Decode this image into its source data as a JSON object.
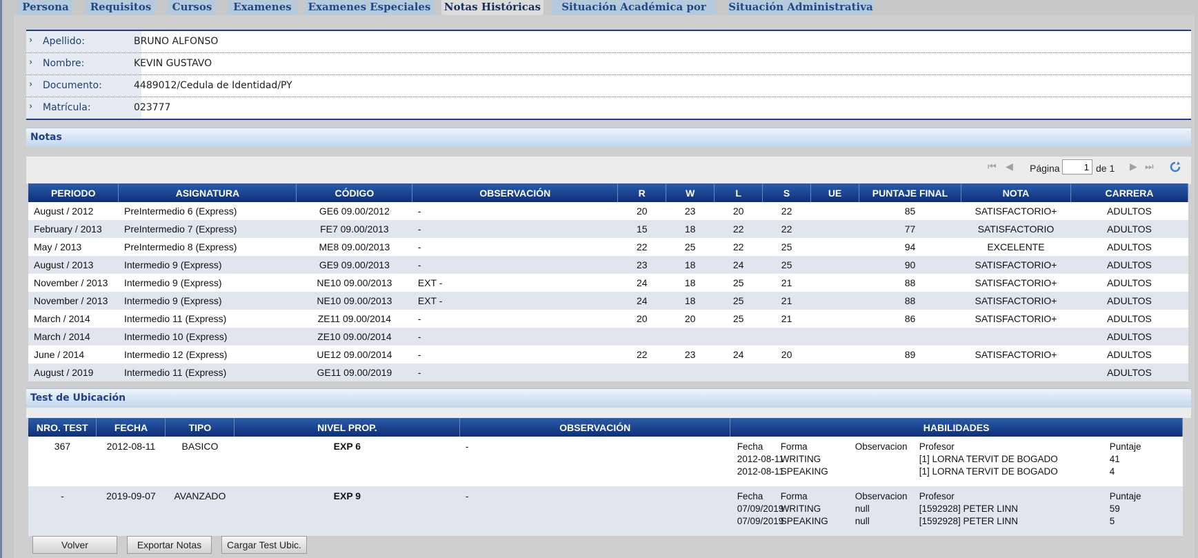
{
  "tabs": [
    {
      "label": "Persona"
    },
    {
      "label": "Requisitos"
    },
    {
      "label": "Cursos"
    },
    {
      "label": "Examenes"
    },
    {
      "label": "Examenes Especiales"
    },
    {
      "label": "Notas Históricas"
    },
    {
      "label": "Situación Académica por Año"
    },
    {
      "label": "Situación Administrativa"
    }
  ],
  "info": {
    "apellido_label": "Apellido:",
    "apellido": "BRUNO ALFONSO",
    "nombre_label": "Nombre:",
    "nombre": "KEVIN GUSTAVO",
    "documento_label": "Documento:",
    "documento": "4489012/Cedula de Identidad/PY",
    "matricula_label": "Matrícula:",
    "matricula": "023777"
  },
  "notas": {
    "title": "Notas",
    "pager": {
      "pagina_label": "Página",
      "page": "1",
      "of_label": "de 1"
    },
    "headers": [
      "PERIODO",
      "ASIGNATURA",
      "CÓDIGO",
      "OBSERVACIÓN",
      "R",
      "W",
      "L",
      "S",
      "UE",
      "PUNTAJE FINAL",
      "NOTA",
      "CARRERA"
    ],
    "rows": [
      [
        "August / 2012",
        "PreIntermedio 6 (Express)",
        "GE6 09.00/2012",
        "-",
        "20",
        "23",
        "20",
        "22",
        "",
        "85",
        "SATISFACTORIO+",
        "ADULTOS"
      ],
      [
        "February / 2013",
        "PreIntermedio 7 (Express)",
        "FE7 09.00/2013",
        "-",
        "15",
        "18",
        "22",
        "22",
        "",
        "77",
        "SATISFACTORIO",
        "ADULTOS"
      ],
      [
        "May / 2013",
        "PreIntermedio 8 (Express)",
        "ME8 09.00/2013",
        "-",
        "22",
        "25",
        "22",
        "25",
        "",
        "94",
        "EXCELENTE",
        "ADULTOS"
      ],
      [
        "August / 2013",
        "Intermedio 9 (Express)",
        "GE9 09.00/2013",
        "-",
        "23",
        "18",
        "24",
        "25",
        "",
        "90",
        "SATISFACTORIO+",
        "ADULTOS"
      ],
      [
        "November / 2013",
        "Intermedio 9 (Express)",
        "NE10 09.00/2013",
        "EXT -",
        "24",
        "18",
        "25",
        "21",
        "",
        "88",
        "SATISFACTORIO+",
        "ADULTOS"
      ],
      [
        "November / 2013",
        "Intermedio 9 (Express)",
        "NE10 09.00/2013",
        "EXT -",
        "24",
        "18",
        "25",
        "21",
        "",
        "88",
        "SATISFACTORIO+",
        "ADULTOS"
      ],
      [
        "March / 2014",
        "Intermedio 11 (Express)",
        "ZE11 09.00/2014",
        "-",
        "20",
        "20",
        "25",
        "21",
        "",
        "86",
        "SATISFACTORIO+",
        "ADULTOS"
      ],
      [
        "March / 2014",
        "Intermedio 10 (Express)",
        "ZE10 09.00/2014",
        "-",
        "",
        "",
        "",
        "",
        "",
        "",
        "",
        "ADULTOS"
      ],
      [
        "June / 2014",
        "Intermedio 12 (Express)",
        "UE12 09.00/2014",
        "-",
        "22",
        "23",
        "24",
        "20",
        "",
        "89",
        "SATISFACTORIO+",
        "ADULTOS"
      ],
      [
        "August / 2019",
        "Intermedio 11 (Express)",
        "GE11 09.00/2019",
        "-",
        "",
        "",
        "",
        "",
        "",
        "",
        "",
        "ADULTOS"
      ]
    ]
  },
  "test": {
    "title": "Test de Ubicación",
    "headers": [
      "NRO. TEST",
      "FECHA",
      "TIPO",
      "NIVEL PROP.",
      "OBSERVACIÓN",
      "HABILIDADES"
    ],
    "hab_headers": [
      "Fecha",
      "Forma",
      "Observacion",
      "Profesor",
      "Puntaje"
    ],
    "rows": [
      {
        "nro": "367",
        "fecha": "2012-08-11",
        "tipo": "BASICO",
        "nivel": "EXP 6",
        "obs": "-",
        "hab": [
          [
            "2012-08-11",
            "WRITING",
            "",
            "[1] LORNA TERVIT DE BOGADO",
            "41"
          ],
          [
            "2012-08-11",
            "SPEAKING",
            "",
            "[1] LORNA TERVIT DE BOGADO",
            "4"
          ]
        ]
      },
      {
        "nro": "-",
        "fecha": "2019-09-07",
        "tipo": "AVANZADO",
        "nivel": "EXP 9",
        "obs": "-",
        "hab": [
          [
            "07/09/2019",
            "WRITING",
            "null",
            "[1592928] PETER LINN",
            "59"
          ],
          [
            "07/09/2019",
            "SPEAKING",
            "null",
            "[1592928] PETER LINN",
            "5"
          ]
        ]
      }
    ]
  },
  "buttons": {
    "volver": "Volver",
    "exportar": "Exportar Notas",
    "cargar": "Cargar Test Ubic."
  }
}
